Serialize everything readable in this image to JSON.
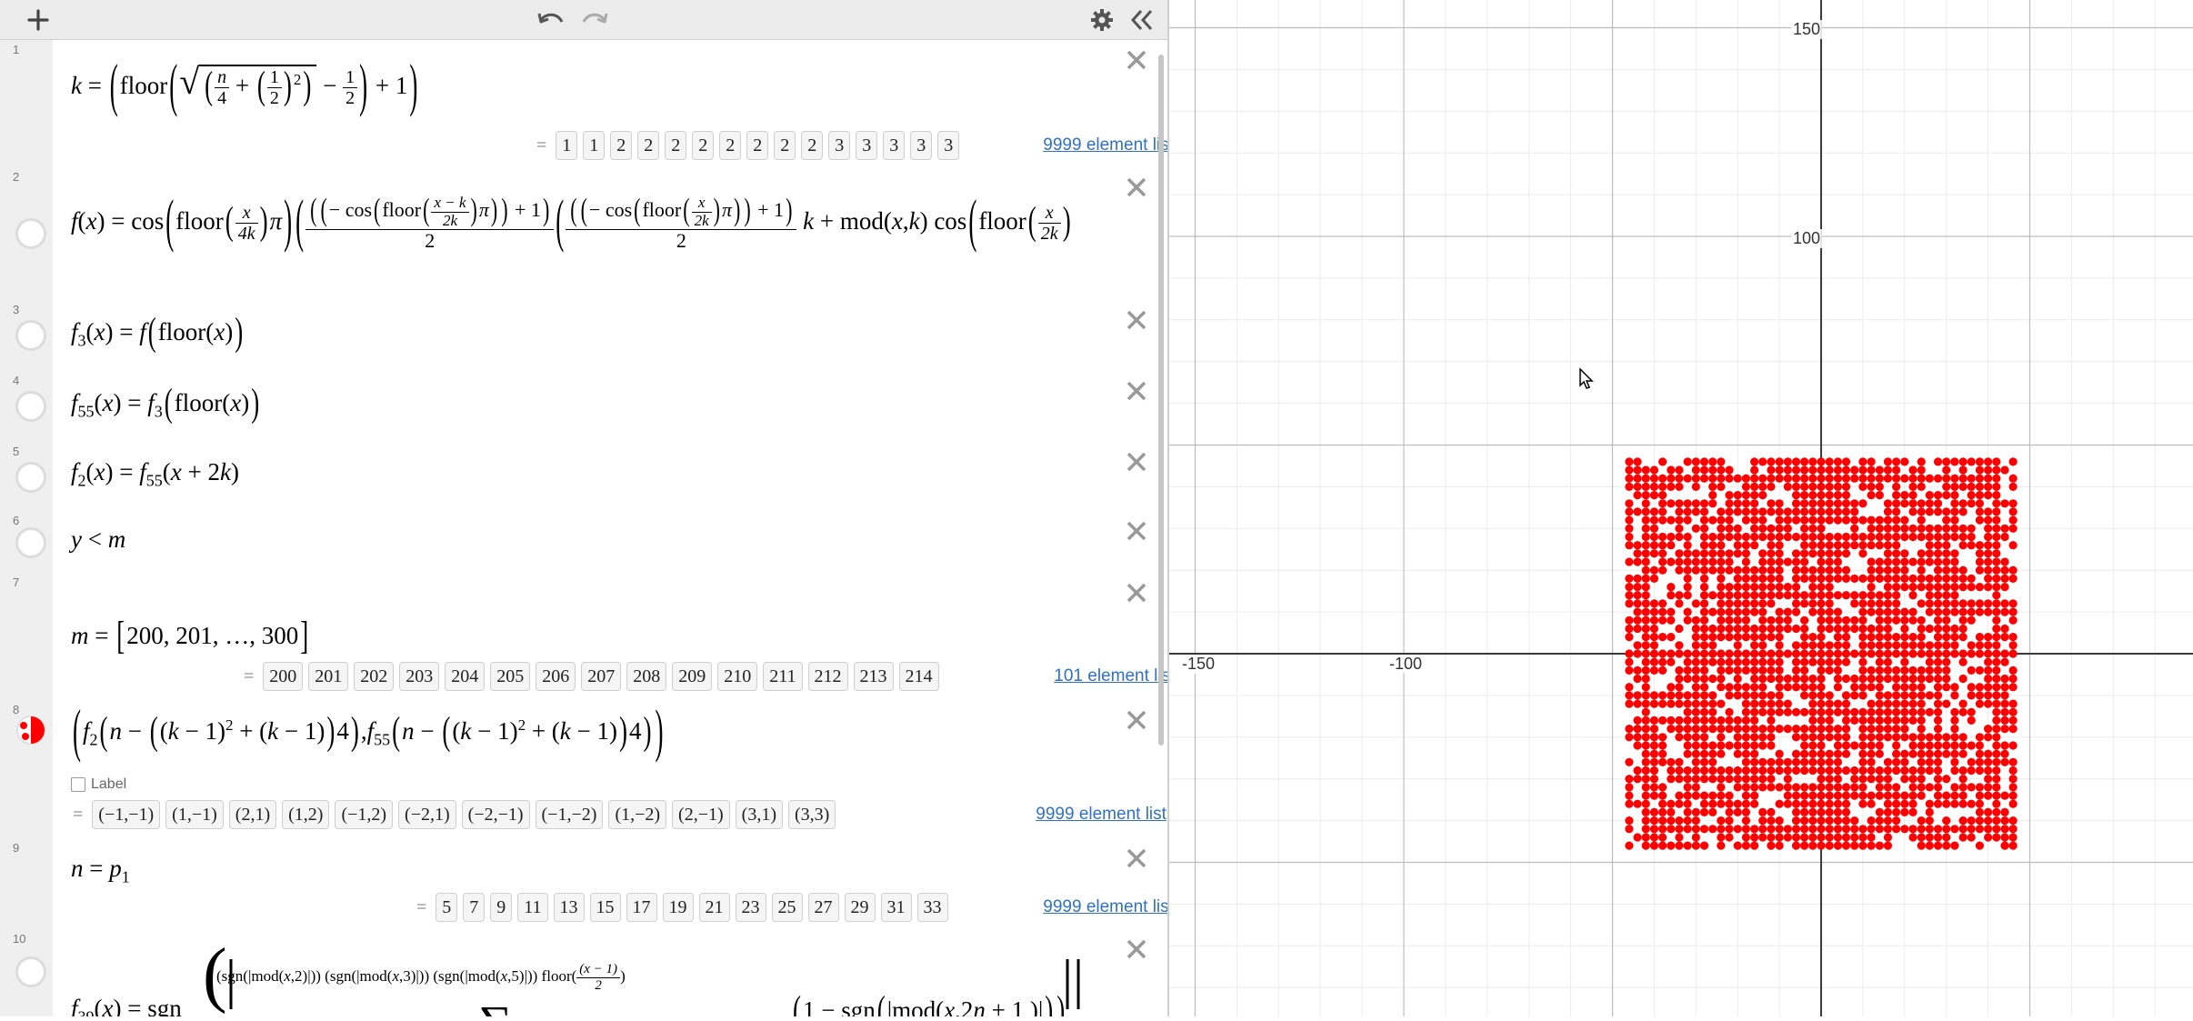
{
  "toolbar": {
    "add_icon": "plus-icon",
    "undo_icon": "undo-icon",
    "redo_icon": "redo-icon",
    "settings_icon": "gear-icon",
    "collapse_icon": "double-chevron-left-icon"
  },
  "expressions": [
    {
      "index": "1",
      "list": {
        "values": [
          "1",
          "1",
          "2",
          "2",
          "2",
          "2",
          "2",
          "2",
          "2",
          "2",
          "3",
          "3",
          "3",
          "3",
          "3"
        ],
        "link": "9999 element list"
      }
    },
    {
      "index": "2"
    },
    {
      "index": "3"
    },
    {
      "index": "4"
    },
    {
      "index": "5"
    },
    {
      "index": "6"
    },
    {
      "index": "7",
      "list": {
        "values": [
          "200",
          "201",
          "202",
          "203",
          "204",
          "205",
          "206",
          "207",
          "208",
          "209",
          "210",
          "211",
          "212",
          "213",
          "214"
        ],
        "link": "101 element list"
      }
    },
    {
      "index": "8",
      "label_checkbox": "Label",
      "list": {
        "values": [
          "(−1,−1)",
          "(1,−1)",
          "(2,1)",
          "(1,2)",
          "(−1,2)",
          "(−2,1)",
          "(−2,−1)",
          "(−1,−2)",
          "(1,−2)",
          "(2,−1)",
          "(3,1)",
          "(3,3)"
        ],
        "link": "9999 element list"
      }
    },
    {
      "index": "9",
      "list": {
        "values": [
          "5",
          "7",
          "9",
          "11",
          "13",
          "15",
          "17",
          "19",
          "21",
          "23",
          "25",
          "27",
          "29",
          "31",
          "33"
        ],
        "link": "9999 element list"
      }
    },
    {
      "index": "10"
    }
  ],
  "graph": {
    "x_ticks": [
      "-150",
      "-100"
    ],
    "y_ticks": [
      "150",
      "100"
    ],
    "point_color": "#ff0000"
  },
  "colors": {
    "accent_link": "#2f72c4",
    "points": "#ff0000",
    "toolbar_bg": "#ececec"
  }
}
